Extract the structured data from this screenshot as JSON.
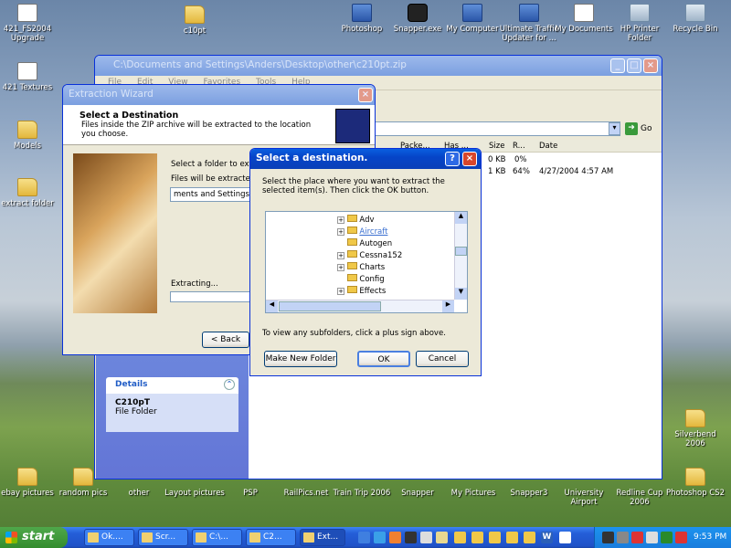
{
  "desktop": {
    "top_icons": [
      {
        "label": "421_FS2004\nUpgrade",
        "icon": "document-icon"
      },
      {
        "label": "c10pt",
        "icon": "folder-icon"
      },
      {
        "label": "Photoshop",
        "icon": "photoshop-icon"
      },
      {
        "label": "Snapper.exe",
        "icon": "camera-icon"
      },
      {
        "label": "My Computer",
        "icon": "computer-icon"
      },
      {
        "label": "Ultimate Traffic\nUpdater for ...",
        "icon": "app-icon"
      },
      {
        "label": "My Documents",
        "icon": "documents-icon"
      },
      {
        "label": "HP Printer\nFolder",
        "icon": "printer-icon"
      },
      {
        "label": "Recycle Bin",
        "icon": "recycle-bin-icon"
      }
    ],
    "left_icons": [
      {
        "label": "421 Textures",
        "icon": "document-icon"
      },
      {
        "label": "Models",
        "icon": "folder-icon"
      },
      {
        "label": "extract folder",
        "icon": "folder-icon"
      }
    ],
    "right_icons": [
      {
        "label": "Silverbend\n2006",
        "icon": "folder-icon"
      }
    ],
    "bottom_icons": [
      {
        "label": "ebay pictures"
      },
      {
        "label": "random pics"
      },
      {
        "label": "other"
      },
      {
        "label": "Layout pictures"
      },
      {
        "label": "PSP"
      },
      {
        "label": "RailPics.net"
      },
      {
        "label": "Train Trip 2006"
      },
      {
        "label": "Snapper"
      },
      {
        "label": "My Pictures"
      },
      {
        "label": "Snapper3"
      },
      {
        "label": "University\nAirport"
      },
      {
        "label": "Redline Cup\n2006"
      },
      {
        "label": "Photoshop CS2"
      }
    ]
  },
  "explorer": {
    "title": "C:\\Documents and Settings\\Anders\\Desktop\\other\\c210pt.zip",
    "menu": [
      "File",
      "Edit",
      "View",
      "Favorites",
      "Tools",
      "Help"
    ],
    "go_label": "Go",
    "columns": [
      "Packe...",
      "Has ...",
      "Size",
      "R...",
      "Date"
    ],
    "rows": [
      {
        "size": "0 KB",
        "ratio": "0%",
        "date": ""
      },
      {
        "size": "1 KB",
        "ratio": "64%",
        "date": "4/27/2004 4:57 AM"
      }
    ],
    "details_header": "Details",
    "details_name": "C210pT",
    "details_type": "File Folder"
  },
  "wizard": {
    "title": "Extraction Wizard",
    "heading": "Select a Destination",
    "description": "Files inside the ZIP archive will be extracted to the location you choose.",
    "select_label": "Select a folder to extract",
    "extract_to_label": "Files will be extracted to",
    "path_value": "ments and Settings\\An",
    "extracting_label": "Extracting...",
    "back_label": "< Back"
  },
  "dialog": {
    "title": "Select a destination.",
    "instruction": "Select the place where you want to extract the selected item(s).  Then click the OK button.",
    "tree": [
      {
        "label": "Adv",
        "expandable": true,
        "selected": false
      },
      {
        "label": "Aircraft",
        "expandable": true,
        "selected": true
      },
      {
        "label": "Autogen",
        "expandable": false,
        "selected": false
      },
      {
        "label": "Cessna152",
        "expandable": true,
        "selected": false
      },
      {
        "label": "Charts",
        "expandable": true,
        "selected": false
      },
      {
        "label": "Config",
        "expandable": false,
        "selected": false
      },
      {
        "label": "Effects",
        "expandable": true,
        "selected": false
      }
    ],
    "hint": "To view any subfolders, click a plus sign above.",
    "new_folder_label": "Make New Folder",
    "ok_label": "OK",
    "cancel_label": "Cancel"
  },
  "taskbar": {
    "start_label": "start",
    "tasks": [
      "Ok....",
      "Scr...",
      "C:\\...",
      "C2...",
      "Ext..."
    ],
    "clock": "9:53 PM"
  },
  "colors": {
    "xp_blue": "#0a5fe0",
    "selected_folder": "#3a6fd0"
  }
}
